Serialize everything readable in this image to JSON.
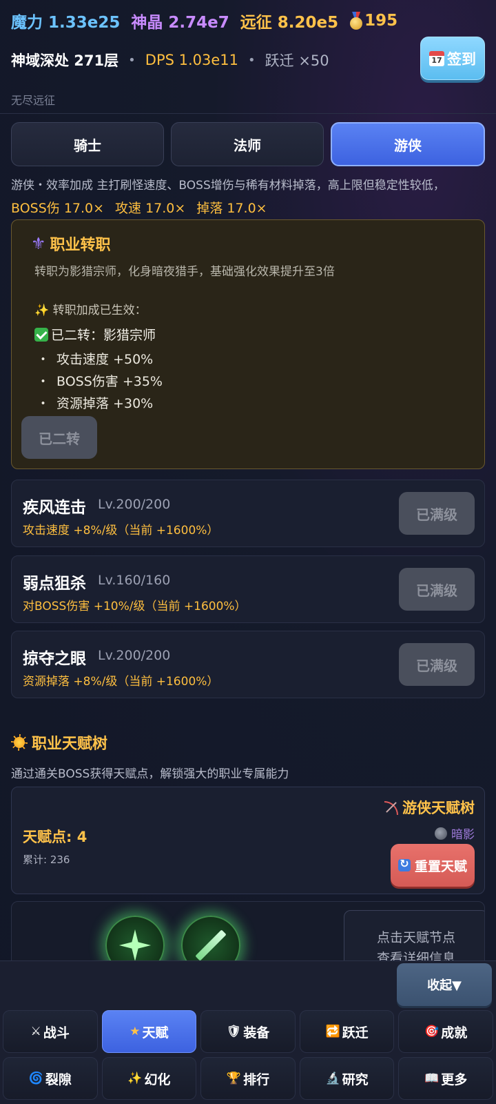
{
  "header": {
    "mana": "魔力 1.33e25",
    "crystal": "神晶 2.74e7",
    "expedition": "远征 8.20e5",
    "medals": "195",
    "location": "神域深处 271层",
    "dps": "DPS 1.03e11",
    "jump": "跃迁 ×50",
    "subtitle": "无尽远征",
    "signin_label": "签到",
    "sep": "•"
  },
  "tabs": [
    {
      "label": "骑士",
      "active": false
    },
    {
      "label": "法师",
      "active": false
    },
    {
      "label": "游侠",
      "active": true
    }
  ],
  "class_info": {
    "desc": "游侠・效率加成  主打刷怪速度、BOSS增伤与稀有材料掉落，高上限但稳定性较低，",
    "bonuses": [
      "BOSS伤 17.0×",
      "攻速 17.0×",
      "掉落 17.0×"
    ]
  },
  "promotion": {
    "icon": "fleur-de-lis-icon",
    "title": "职业转职",
    "text": "转职为影猎宗师，化身暗夜猎手，基础强化效果提升至3倍",
    "active_label": "✨ 转职加成已生效：",
    "status": "已二转：影猎宗师",
    "bullet": "・",
    "effects": [
      "攻击速度 +50%",
      "BOSS伤害 +35%",
      "资源掉落 +30%"
    ],
    "button_label": "已二转"
  },
  "skills": [
    {
      "name": "疾风连击",
      "level": "Lv.200/200",
      "effect": "攻击速度 +8%/级（当前 +1600%）",
      "button": "已满级"
    },
    {
      "name": "弱点狙杀",
      "level": "Lv.160/160",
      "effect": "对BOSS伤害 +10%/级（当前 +1600%）",
      "button": "已满级"
    },
    {
      "name": "掠夺之眼",
      "level": "Lv.200/200",
      "effect": "资源掉落 +8%/级（当前 +1600%）",
      "button": "已满级"
    }
  ],
  "talent": {
    "heading": "职业天赋树",
    "desc": "通过通关BOSS获得天赋点，解锁强大的职业专属能力",
    "points": "天赋点: 4",
    "total": "累计: 236",
    "tree_name": "游侠天赋树",
    "branch": "暗影",
    "reset_label": "重置天赋",
    "hint_line1": "点击天赋节点",
    "hint_line2": "查看详细信息"
  },
  "bottom_nav": {
    "collapse_label": "收起▼",
    "items": [
      {
        "label": "战斗",
        "icon": "⚔",
        "active": false
      },
      {
        "label": "天赋",
        "icon": "★",
        "active": true
      },
      {
        "label": "装备",
        "icon": "🛡",
        "active": false
      },
      {
        "label": "跃迁",
        "icon": "🔁",
        "active": false
      },
      {
        "label": "成就",
        "icon": "🎯",
        "active": false
      },
      {
        "label": "裂隙",
        "icon": "🌀",
        "active": false
      },
      {
        "label": "幻化",
        "icon": "✨",
        "active": false
      },
      {
        "label": "排行",
        "icon": "🏆",
        "active": false
      },
      {
        "label": "研究",
        "icon": "🔬",
        "active": false
      },
      {
        "label": "更多",
        "icon": "📖",
        "active": false
      }
    ]
  }
}
